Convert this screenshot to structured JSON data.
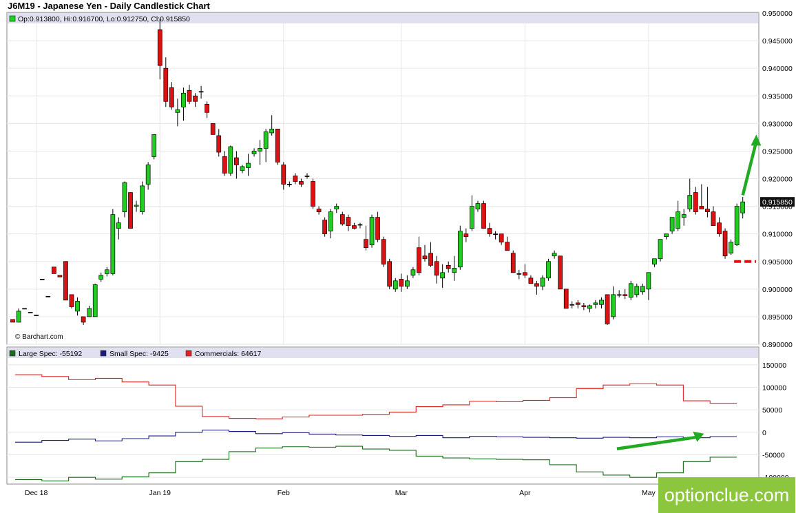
{
  "title": "J6M19 - Japanese Yen - Daily Candlestick Chart",
  "ohlc_text": "Op:0.913800, Hi:0.916700, Lo:0.912750, Cl:0.915850",
  "copyright": "© Barchart.com",
  "last_price_label": "0.915850",
  "watermark": "optionclue.com",
  "colors": {
    "up": "#22cc22",
    "down": "#dd1111",
    "large_spec": "#1a6b1a",
    "small_spec": "#1a1a80",
    "commercials": "#dd2222",
    "annotation": "#22aa22",
    "support": "#dd1111",
    "legend_bg": "#e0e0f0"
  },
  "chart_data": [
    {
      "type": "candlestick",
      "title": "J6M19 - Japanese Yen - Daily Candlestick Chart",
      "ylim": [
        0.89,
        0.95
      ],
      "y_ticks": [
        "0.890000",
        "0.895000",
        "0.900000",
        "0.905000",
        "0.910000",
        "0.915000",
        "0.920000",
        "0.925000",
        "0.930000",
        "0.935000",
        "0.940000",
        "0.945000",
        "0.950000"
      ],
      "x_labels": [
        {
          "label": "Dec 18",
          "index": 4
        },
        {
          "label": "Jan 19",
          "index": 25
        },
        {
          "label": "Feb",
          "index": 46
        },
        {
          "label": "Mar",
          "index": 66
        },
        {
          "label": "Apr",
          "index": 87
        },
        {
          "label": "May",
          "index": 108
        }
      ],
      "candles": [
        [
          0.8945,
          0.8945,
          0.894,
          0.894
        ],
        [
          0.894,
          0.8965,
          0.894,
          0.896
        ],
        [
          0.8965,
          0.8965,
          0.8965,
          0.8965
        ],
        [
          0.8958,
          0.8958,
          0.8958,
          0.8958
        ],
        [
          0.8953,
          0.8953,
          0.8953,
          0.8953
        ],
        [
          0.9018,
          0.9018,
          0.9018,
          0.9018
        ],
        [
          0.8987,
          0.8987,
          0.8987,
          0.8987
        ],
        [
          0.904,
          0.904,
          0.9028,
          0.9028
        ],
        [
          0.9025,
          0.9025,
          0.9022,
          0.9022
        ],
        [
          0.905,
          0.905,
          0.898,
          0.898
        ],
        [
          0.899,
          0.899,
          0.8965,
          0.8968
        ],
        [
          0.896,
          0.8985,
          0.8952,
          0.8978
        ],
        [
          0.895,
          0.895,
          0.8935,
          0.894
        ],
        [
          0.895,
          0.897,
          0.895,
          0.8965
        ],
        [
          0.895,
          0.901,
          0.895,
          0.9008
        ],
        [
          0.9018,
          0.903,
          0.9013,
          0.9025
        ],
        [
          0.9028,
          0.904,
          0.9023,
          0.9035
        ],
        [
          0.9028,
          0.9145,
          0.9025,
          0.9135
        ],
        [
          0.911,
          0.913,
          0.909,
          0.912
        ],
        [
          0.914,
          0.9195,
          0.913,
          0.9193
        ],
        [
          0.9175,
          0.9175,
          0.911,
          0.911
        ],
        [
          0.915,
          0.916,
          0.914,
          0.9152
        ],
        [
          0.914,
          0.9195,
          0.9135,
          0.9187
        ],
        [
          0.919,
          0.923,
          0.918,
          0.9225
        ],
        [
          0.924,
          0.928,
          0.9235,
          0.928
        ],
        [
          0.947,
          0.949,
          0.938,
          0.9405
        ],
        [
          0.94,
          0.942,
          0.933,
          0.934
        ],
        [
          0.9365,
          0.9375,
          0.9325,
          0.933
        ],
        [
          0.932,
          0.9345,
          0.9295,
          0.9325
        ],
        [
          0.933,
          0.9365,
          0.9305,
          0.9355
        ],
        [
          0.936,
          0.937,
          0.9335,
          0.934
        ],
        [
          0.935,
          0.9355,
          0.933,
          0.934
        ],
        [
          0.9358,
          0.9368,
          0.9345,
          0.9358
        ],
        [
          0.9335,
          0.934,
          0.931,
          0.932
        ],
        [
          0.93,
          0.93,
          0.928,
          0.928
        ],
        [
          0.9278,
          0.929,
          0.924,
          0.9248
        ],
        [
          0.924,
          0.925,
          0.9205,
          0.921
        ],
        [
          0.921,
          0.926,
          0.9205,
          0.9258
        ],
        [
          0.9238,
          0.925,
          0.92,
          0.9225
        ],
        [
          0.9215,
          0.9225,
          0.921,
          0.9222
        ],
        [
          0.922,
          0.9245,
          0.9205,
          0.9228
        ],
        [
          0.9245,
          0.9255,
          0.924,
          0.925
        ],
        [
          0.925,
          0.927,
          0.9225,
          0.9255
        ],
        [
          0.9255,
          0.929,
          0.923,
          0.9285
        ],
        [
          0.9283,
          0.9315,
          0.9278,
          0.929
        ],
        [
          0.929,
          0.929,
          0.9225,
          0.923
        ],
        [
          0.9225,
          0.923,
          0.918,
          0.919
        ],
        [
          0.919,
          0.9195,
          0.9185,
          0.919
        ],
        [
          0.9205,
          0.921,
          0.919,
          0.9195
        ],
        [
          0.9195,
          0.92,
          0.9185,
          0.919
        ],
        [
          0.9205,
          0.921,
          0.92,
          0.9205
        ],
        [
          0.9195,
          0.92,
          0.9145,
          0.915
        ],
        [
          0.9145,
          0.915,
          0.9135,
          0.914
        ],
        [
          0.9125,
          0.913,
          0.9095,
          0.91
        ],
        [
          0.9105,
          0.9145,
          0.9092,
          0.914
        ],
        [
          0.9145,
          0.9155,
          0.9138,
          0.915
        ],
        [
          0.9135,
          0.914,
          0.9115,
          0.9118
        ],
        [
          0.913,
          0.9135,
          0.9105,
          0.9115
        ],
        [
          0.9115,
          0.912,
          0.9108,
          0.911
        ],
        [
          0.9117,
          0.912,
          0.911,
          0.9117
        ],
        [
          0.909,
          0.9115,
          0.907,
          0.9075
        ],
        [
          0.908,
          0.9135,
          0.9075,
          0.913
        ],
        [
          0.913,
          0.914,
          0.9085,
          0.909
        ],
        [
          0.909,
          0.9095,
          0.904,
          0.9045
        ],
        [
          0.905,
          0.9055,
          0.9,
          0.9005
        ],
        [
          0.9,
          0.902,
          0.8995,
          0.9015
        ],
        [
          0.9018,
          0.9028,
          0.8995,
          0.9005
        ],
        [
          0.9005,
          0.9025,
          0.9,
          0.9015
        ],
        [
          0.9025,
          0.904,
          0.902,
          0.9035
        ],
        [
          0.9075,
          0.9095,
          0.9025,
          0.903
        ],
        [
          0.906,
          0.908,
          0.905,
          0.9055
        ],
        [
          0.9065,
          0.9085,
          0.904,
          0.9043
        ],
        [
          0.905,
          0.906,
          0.901,
          0.9025
        ],
        [
          0.902,
          0.9045,
          0.9002,
          0.903
        ],
        [
          0.9043,
          0.905,
          0.903,
          0.9037
        ],
        [
          0.903,
          0.906,
          0.9015,
          0.9038
        ],
        [
          0.904,
          0.9115,
          0.9035,
          0.9105
        ],
        [
          0.91,
          0.911,
          0.9085,
          0.9095
        ],
        [
          0.911,
          0.917,
          0.9105,
          0.915
        ],
        [
          0.9145,
          0.916,
          0.914,
          0.9155
        ],
        [
          0.9155,
          0.916,
          0.911,
          0.911
        ],
        [
          0.911,
          0.912,
          0.9095,
          0.91
        ],
        [
          0.91,
          0.9105,
          0.909,
          0.91
        ],
        [
          0.91,
          0.91,
          0.908,
          0.9085
        ],
        [
          0.9085,
          0.9095,
          0.907,
          0.907
        ],
        [
          0.9065,
          0.907,
          0.903,
          0.903
        ],
        [
          0.9028,
          0.9035,
          0.9018,
          0.9028
        ],
        [
          0.903,
          0.9045,
          0.902,
          0.9025
        ],
        [
          0.902,
          0.9025,
          0.901,
          0.901
        ],
        [
          0.901,
          0.9015,
          0.899,
          0.9005
        ],
        [
          0.9005,
          0.9025,
          0.8998,
          0.902
        ],
        [
          0.902,
          0.9055,
          0.9015,
          0.905
        ],
        [
          0.906,
          0.907,
          0.9055,
          0.9065
        ],
        [
          0.906,
          0.906,
          0.9,
          0.9
        ],
        [
          0.9,
          0.9,
          0.8965,
          0.8965
        ],
        [
          0.8972,
          0.8978,
          0.8965,
          0.8972
        ],
        [
          0.8975,
          0.898,
          0.8965,
          0.8972
        ],
        [
          0.897,
          0.8975,
          0.8962,
          0.8968
        ],
        [
          0.8965,
          0.8972,
          0.8958,
          0.897
        ],
        [
          0.8972,
          0.898,
          0.8965,
          0.8975
        ],
        [
          0.8972,
          0.8985,
          0.8965,
          0.898
        ],
        [
          0.899,
          0.899,
          0.8935,
          0.8937
        ],
        [
          0.895,
          0.9005,
          0.8945,
          0.899
        ],
        [
          0.899,
          0.8998,
          0.8985,
          0.899
        ],
        [
          0.899,
          0.9,
          0.8982,
          0.8988
        ],
        [
          0.8985,
          0.9015,
          0.898,
          0.901
        ],
        [
          0.899,
          0.901,
          0.8985,
          0.9005
        ],
        [
          0.8995,
          0.901,
          0.899,
          0.9005
        ],
        [
          0.9,
          0.903,
          0.898,
          0.903
        ],
        [
          0.9045,
          0.9055,
          0.904,
          0.9055
        ],
        [
          0.9055,
          0.909,
          0.905,
          0.909
        ],
        [
          0.9095,
          0.91,
          0.909,
          0.91
        ],
        [
          0.9105,
          0.913,
          0.91,
          0.913
        ],
        [
          0.911,
          0.916,
          0.9105,
          0.914
        ],
        [
          0.913,
          0.9145,
          0.9115,
          0.9135
        ],
        [
          0.9145,
          0.92,
          0.914,
          0.917
        ],
        [
          0.9175,
          0.9185,
          0.9135,
          0.914
        ],
        [
          0.915,
          0.919,
          0.9145,
          0.9145
        ],
        [
          0.9145,
          0.9185,
          0.913,
          0.914
        ],
        [
          0.914,
          0.915,
          0.9115,
          0.9115
        ],
        [
          0.912,
          0.913,
          0.9095,
          0.91
        ],
        [
          0.9105,
          0.911,
          0.9055,
          0.906
        ],
        [
          0.9065,
          0.909,
          0.9062,
          0.9085
        ],
        [
          0.908,
          0.9155,
          0.9078,
          0.915
        ],
        [
          0.9138,
          0.9167,
          0.9128,
          0.9158
        ]
      ],
      "annotations": {
        "support_level": 0.905,
        "support_from_index": 123,
        "arrow_from": {
          "index": 124,
          "value": 0.917
        },
        "arrow_to": {
          "index": 127,
          "value": 0.928
        }
      }
    },
    {
      "type": "line",
      "title": "COT positions",
      "ylim": [
        -115000,
        165000
      ],
      "y_ticks": [
        "150000",
        "100000",
        "50000",
        "0",
        "-50000",
        "-100000"
      ],
      "series": [
        {
          "name": "Large Spec: -55192",
          "values": [
            -105000,
            -108000,
            -100000,
            -104000,
            -99000,
            -90000,
            -65000,
            -60000,
            -43000,
            -35000,
            -32000,
            -33000,
            -31000,
            -37000,
            -40000,
            -53000,
            -57000,
            -59000,
            -60000,
            -61000,
            -72000,
            -88000,
            -95000,
            -100000,
            -90000,
            -65000,
            -55192
          ]
        },
        {
          "name": "Small Spec: -9425",
          "values": [
            -22000,
            -18000,
            -15000,
            -19000,
            -14000,
            -8000,
            0,
            5000,
            2000,
            -3000,
            -1000,
            -4000,
            -6000,
            -7000,
            -9000,
            -7000,
            -12000,
            -9000,
            -10000,
            -11000,
            -12000,
            -13000,
            -11000,
            -12000,
            -10000,
            -12000,
            -9425
          ]
        },
        {
          "name": "Commercials: 64617",
          "values": [
            128000,
            124000,
            117000,
            120000,
            112000,
            105000,
            58000,
            35000,
            31000,
            30000,
            34000,
            38000,
            38000,
            40000,
            45000,
            57000,
            61000,
            69000,
            68000,
            71000,
            77000,
            97000,
            105000,
            108000,
            105000,
            70000,
            64617
          ]
        }
      ],
      "annotations": {
        "arrow_from": {
          "step": 22,
          "value": -55000
        },
        "arrow_to": {
          "step": 25,
          "value": -3000
        }
      }
    }
  ]
}
